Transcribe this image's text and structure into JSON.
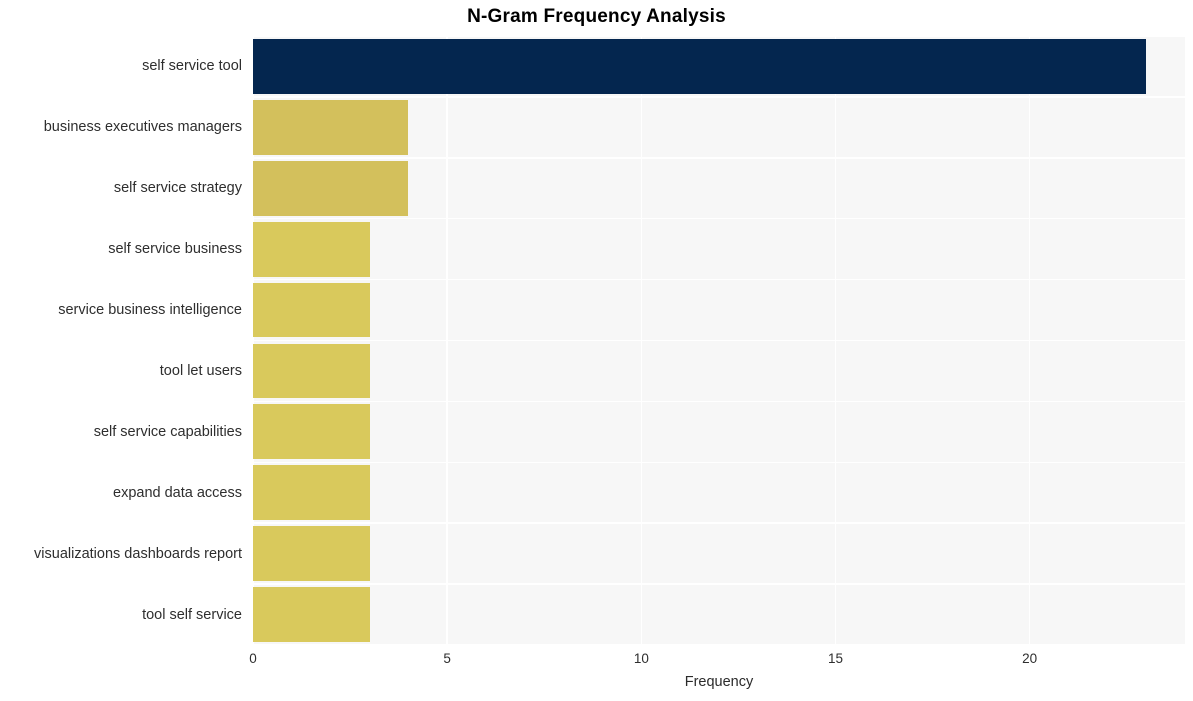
{
  "chart_data": {
    "type": "bar",
    "orientation": "horizontal",
    "title": "N-Gram Frequency Analysis",
    "xlabel": "Frequency",
    "ylabel": "",
    "categories": [
      "self service tool",
      "business executives managers",
      "self service strategy",
      "self service business",
      "service business intelligence",
      "tool let users",
      "self service capabilities",
      "expand data access",
      "visualizations dashboards report",
      "tool self service"
    ],
    "values": [
      23,
      4,
      4,
      3,
      3,
      3,
      3,
      3,
      3,
      3
    ],
    "bar_colors": [
      "#04264f",
      "#d3c05c",
      "#d3c05c",
      "#d9c95c",
      "#d9c95c",
      "#d9c95c",
      "#d9c95c",
      "#d9c95c",
      "#d9c95c",
      "#d9c95c"
    ],
    "xlim": [
      0,
      24.0
    ],
    "xticks": [
      0,
      5,
      10,
      15,
      20
    ],
    "xtick_labels": [
      "0",
      "5",
      "10",
      "15",
      "20"
    ],
    "grid": {
      "vertical": true,
      "horizontal": true,
      "color": "#ffffff"
    },
    "plot_background": "#f7f7f7",
    "figure_background": "#ffffff",
    "legend": null
  }
}
